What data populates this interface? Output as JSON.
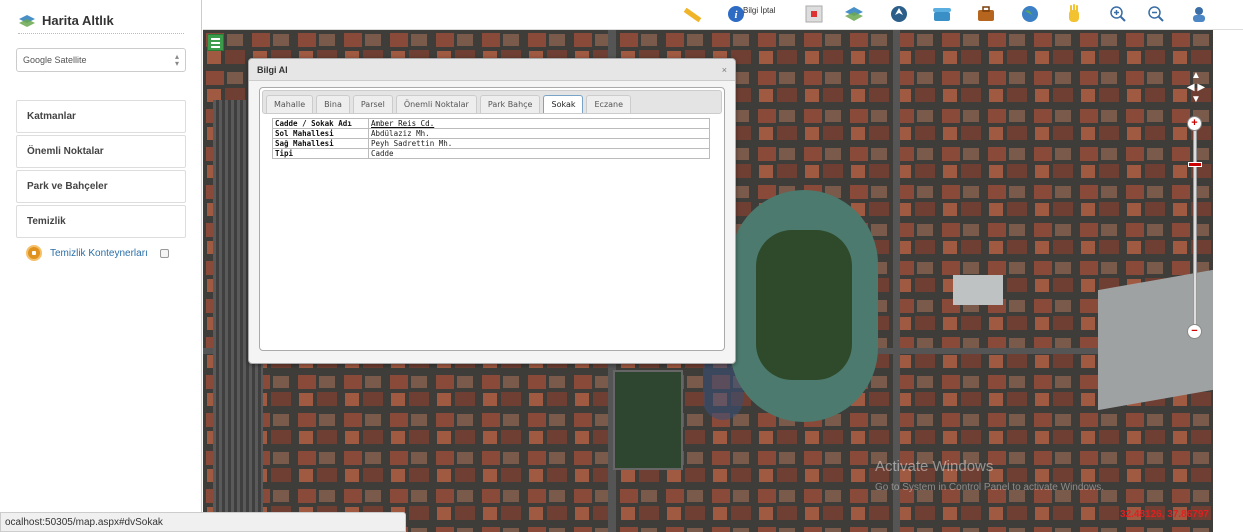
{
  "sidebar": {
    "title": "Harita Altlık",
    "basemap_select": "Google Satellite",
    "items": [
      {
        "label": "Katmanlar"
      },
      {
        "label": "Önemli Noktalar"
      },
      {
        "label": "Park ve Bahçeler"
      },
      {
        "label": "Temizlik"
      }
    ],
    "subitem": {
      "label": "Temizlik Konteynerları",
      "checked": false
    }
  },
  "toolbar": {
    "icons": [
      "ruler-icon",
      "info-icon",
      "grid-icon",
      "layers-icon",
      "navigation-icon",
      "telephone-icon",
      "briefcase-icon",
      "globe-icon",
      "pan-hand-icon",
      "zoom-in-icon",
      "zoom-out-icon",
      "user-icon"
    ],
    "info_cancel_label": "Bilgi İptal"
  },
  "dialog": {
    "title": "Bilgi Al",
    "close": "×",
    "tabs": [
      {
        "label": "Mahalle",
        "active": false
      },
      {
        "label": "Bina",
        "active": false
      },
      {
        "label": "Parsel",
        "active": false
      },
      {
        "label": "Önemli Noktalar",
        "active": false
      },
      {
        "label": "Park Bahçe",
        "active": false
      },
      {
        "label": "Sokak",
        "active": true
      },
      {
        "label": "Eczane",
        "active": false
      }
    ],
    "rows": [
      {
        "key": "Cadde / Sokak Adı",
        "value": "Amber Reis Cd.",
        "link": true
      },
      {
        "key": "Sol Mahallesi",
        "value": "Abdülaziz Mh.",
        "link": false
      },
      {
        "key": "Sağ Mahallesi",
        "value": "Peyh Sadrettin Mh.",
        "link": false
      },
      {
        "key": "Tipi",
        "value": "Cadde",
        "link": false
      }
    ]
  },
  "map": {
    "watermark_title": "Activate Windows",
    "watermark_text": "Go to System in Control Panel to activate Windows.",
    "coordinates": "32.48126, 37.86797"
  },
  "status_url": "ocalhost:50305/map.aspx#dvSokak"
}
